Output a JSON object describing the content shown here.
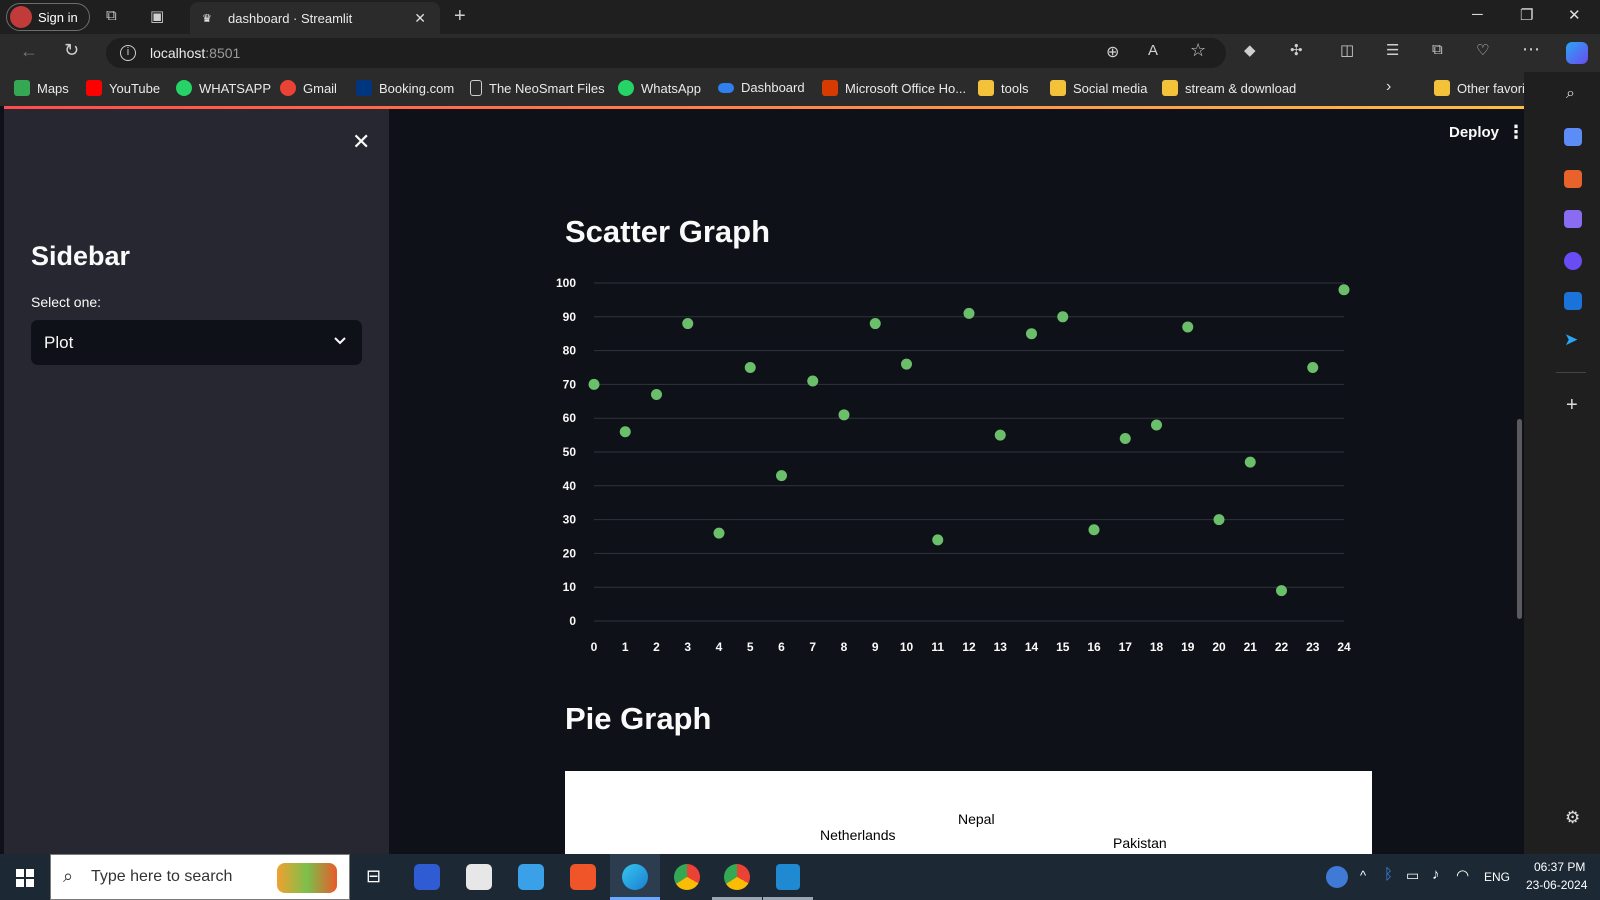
{
  "browser": {
    "signin_label": "Sign in",
    "tab_title": "dashboard · Streamlit",
    "url_host": "localhost",
    "url_port": ":8501",
    "favorites": [
      {
        "label": "Maps",
        "color": "#34a853"
      },
      {
        "label": "YouTube",
        "color": "#ff0000"
      },
      {
        "label": "WHATSAPP",
        "color": "#25d366"
      },
      {
        "label": "Gmail",
        "color": "#ea4335"
      },
      {
        "label": "Booking.com",
        "color": "#003580"
      },
      {
        "label": "The NeoSmart Files",
        "color": "#cfcfcf"
      },
      {
        "label": "WhatsApp",
        "color": "#25d366"
      },
      {
        "label": "Dashboard",
        "color": "#2f80ed"
      },
      {
        "label": "Microsoft Office Ho...",
        "color": "#d83b01"
      },
      {
        "label": "tools",
        "color": "#f3c13a"
      },
      {
        "label": "Social media",
        "color": "#f3c13a"
      },
      {
        "label": "stream & download",
        "color": "#f3c13a"
      }
    ],
    "other_favorites": "Other favorites"
  },
  "sidebar": {
    "title": "Sidebar",
    "select_label": "Select one:",
    "select_value": "Plot"
  },
  "header": {
    "deploy_label": "Deploy"
  },
  "main": {
    "scatter_title": "Scatter Graph",
    "pie_title": "Pie Graph",
    "pie_labels": [
      "Netherlands",
      "Nepal",
      "Pakistan"
    ]
  },
  "chart_data": {
    "type": "scatter",
    "title": "Scatter Graph",
    "xlabel": "",
    "ylabel": "",
    "x": [
      0,
      1,
      2,
      3,
      4,
      5,
      6,
      7,
      8,
      9,
      10,
      11,
      12,
      13,
      14,
      15,
      16,
      17,
      18,
      19,
      20,
      21,
      22,
      23,
      24
    ],
    "y": [
      70,
      56,
      67,
      88,
      26,
      75,
      43,
      71,
      61,
      88,
      76,
      24,
      91,
      55,
      85,
      90,
      27,
      54,
      58,
      87,
      30,
      47,
      9,
      75,
      98
    ],
    "xlim": [
      0,
      24
    ],
    "ylim": [
      0,
      100
    ],
    "yticks": [
      0,
      10,
      20,
      30,
      40,
      50,
      60,
      70,
      80,
      90,
      100
    ],
    "grid": true,
    "point_color": "#6bbf6b"
  },
  "taskbar": {
    "search_placeholder": "Type here to search",
    "lang": "ENG",
    "time": "06:37 PM",
    "date": "23-06-2024"
  }
}
